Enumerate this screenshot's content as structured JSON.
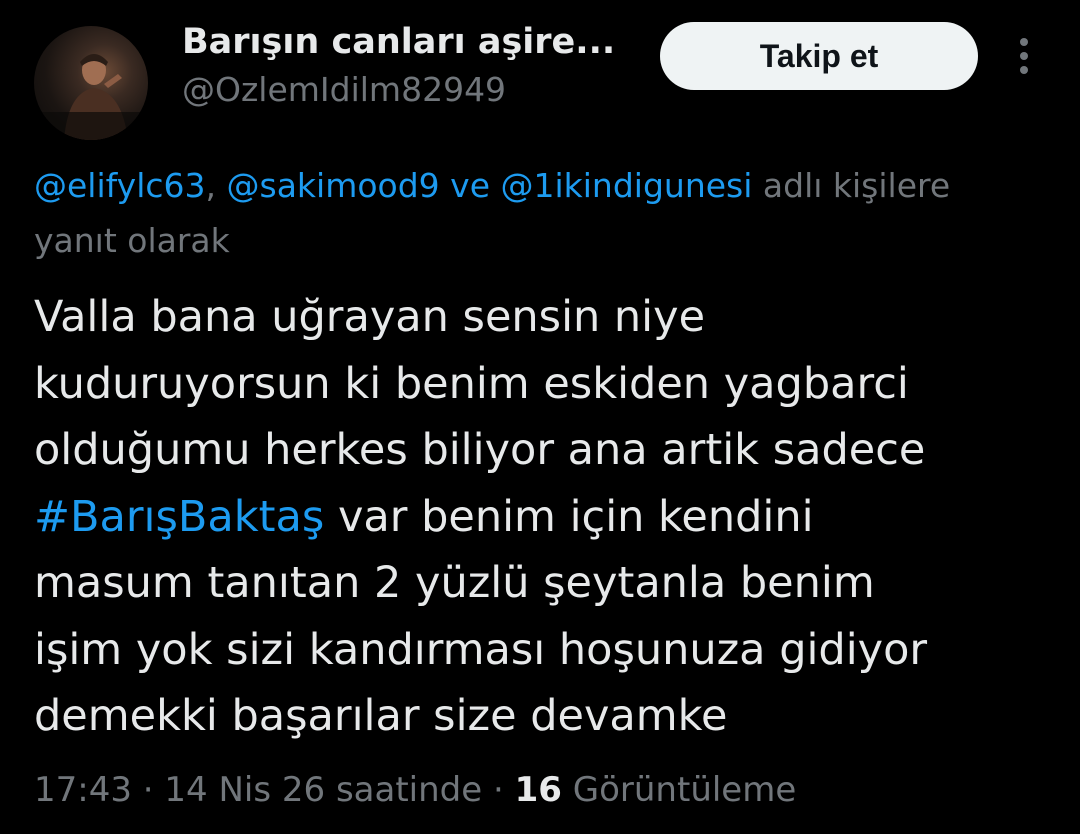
{
  "user": {
    "display_name": "Barışın canları aşire...",
    "handle": "@OzlemIdilm82949",
    "follow_label": "Takip et"
  },
  "reply_context": {
    "mention_1": "@elifylc63",
    "sep_1": ", ",
    "mention_2": "@sakimood9",
    "sep_2": " ve ",
    "mention_3": "@1ikindigunesi",
    "suffix_1": " adlı kişilere",
    "suffix_2": "yanıt olarak"
  },
  "tweet": {
    "line_1": "Valla  bana uğrayan sensin niye",
    "line_2": "kuduruyorsun ki  benim eskiden yagbarci",
    "line_3": "olduğumu herkes biliyor ana artik sadece",
    "hashtag": "#BarışBaktaş",
    "line_4_rest": " var benim için kendini",
    "line_5": "masum tanıtan 2 yüzlü şeytanla benim",
    "line_6": "işim yok sizi kandırması hoşunuza gidiyor",
    "line_7": "demekki başarılar size devamke"
  },
  "meta": {
    "time": "17:43",
    "dot_1": " · ",
    "date": "14 Nis 26 saatinde",
    "dot_2": " · ",
    "views_count": "16",
    "views_label": " Görüntüleme"
  },
  "colors": {
    "background": "#000000",
    "text_primary": "#e7e9ea",
    "text_secondary": "#71767b",
    "accent": "#1d9bf0",
    "button_bg": "#eff3f4"
  },
  "icons": {
    "more": "more-vertical-icon"
  }
}
